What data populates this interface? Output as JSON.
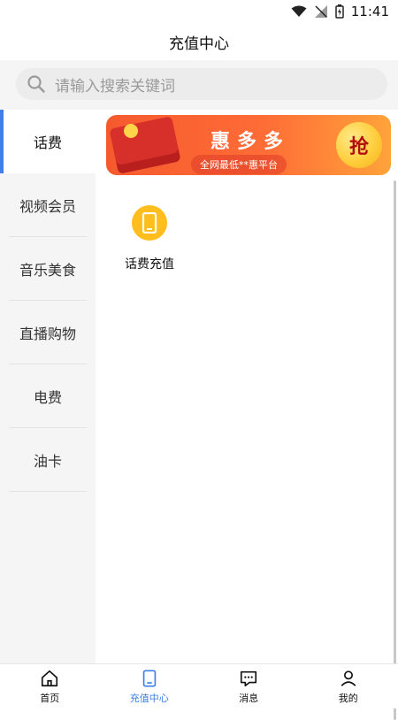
{
  "status": {
    "time": "11:41"
  },
  "page": {
    "title": "充值中心"
  },
  "search": {
    "placeholder": "请输入搜索关键词"
  },
  "sidebar": {
    "items": [
      {
        "label": "话费",
        "active": true
      },
      {
        "label": "视频会员",
        "active": false
      },
      {
        "label": "音乐美食",
        "active": false
      },
      {
        "label": "直播购物",
        "active": false
      },
      {
        "label": "电费",
        "active": false
      },
      {
        "label": "油卡",
        "active": false
      }
    ]
  },
  "banner": {
    "title": "惠多多",
    "subtitle": "全网最低**惠平台",
    "grab_label": "抢"
  },
  "main": {
    "products": [
      {
        "label": "话费充值",
        "icon": "phone-icon"
      }
    ]
  },
  "bottom_nav": {
    "items": [
      {
        "label": "首页",
        "icon": "home-icon",
        "active": false
      },
      {
        "label": "充值中心",
        "icon": "tablet-icon",
        "active": true
      },
      {
        "label": "消息",
        "icon": "message-icon",
        "active": false
      },
      {
        "label": "我的",
        "icon": "user-icon",
        "active": false
      }
    ]
  },
  "colors": {
    "accent": "#3f7fe6",
    "product_icon": "#ffbe1d",
    "banner_orange": "#ff6c36"
  }
}
